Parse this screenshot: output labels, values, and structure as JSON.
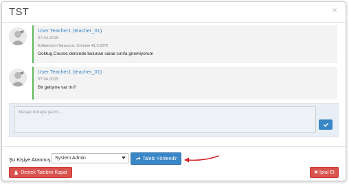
{
  "modal": {
    "title": "TST",
    "close_glyph": "×"
  },
  "messages": [
    {
      "author": "User Teacher1 (teacher_01)",
      "date": "07.04.2015",
      "meta": "Kullanıcının Tarayıcısı: Chrome 41.0.2272",
      "text": "Goktug Course dersinde bulunan sanal sınıfa giremiyorum"
    },
    {
      "author": "User Teacher1 (teacher_01)",
      "date": "07.04.2015",
      "text": "Bir gelişme var mı?"
    }
  ],
  "composer": {
    "placeholder": "Mesajı buraya yazın..."
  },
  "assign": {
    "label": "Şu Kişiye Atanmış",
    "selected": "System Admin"
  },
  "buttons": {
    "forward": "Talebi Yönlendir",
    "close_ticket": "Destek Talebini Kapat",
    "cancel": "İptal Et"
  },
  "colors": {
    "primary": "#3a87c8",
    "danger": "#d9534f",
    "accent_border": "#5cb85c",
    "annotation_arrow": "#d9232a"
  }
}
